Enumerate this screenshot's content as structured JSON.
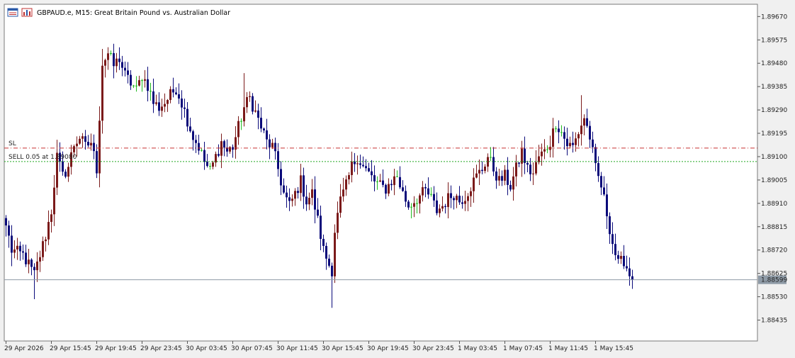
{
  "header": {
    "title": "GBPAUD.e, M15:  Great Britain Pound vs. Australian Dollar",
    "icons": [
      "chart-window-icon",
      "chart-bars-icon"
    ]
  },
  "levels": {
    "sl_label": "SL",
    "sl_price": 1.89135,
    "sell_label": "SELL 0.05 at 1.89080",
    "sell_price": 1.8908,
    "current_price": 1.88599,
    "current_price_label": "1.88599"
  },
  "colors": {
    "background": "#ffffff",
    "frame": "#f0f0f0",
    "bull": "#7b1a1a",
    "bear": "#0a0a7a",
    "doji": "#22bb22",
    "sl_line": "#c83232",
    "sell_line": "#22a822",
    "price_line": "#8e9aa6",
    "price_tag": "#8e9aa6"
  },
  "chart_data": {
    "type": "candlestick",
    "symbol": "GBPAUD.e",
    "timeframe": "M15",
    "ylim": [
      1.8835,
      1.8972
    ],
    "y_ticks": [
      "1.89670",
      "1.89575",
      "1.89480",
      "1.89385",
      "1.89290",
      "1.89195",
      "1.89100",
      "1.89005",
      "1.88910",
      "1.88815",
      "1.88720",
      "1.88625",
      "1.88530",
      "1.88435"
    ],
    "x_ticks": [
      "29 Apr 2026",
      "29 Apr 15:45",
      "29 Apr 19:45",
      "29 Apr 23:45",
      "30 Apr 03:45",
      "30 Apr 07:45",
      "30 Apr 11:45",
      "30 Apr 15:45",
      "30 Apr 19:45",
      "30 Apr 23:45",
      "1 May 03:45",
      "1 May 07:45",
      "1 May 11:45",
      "1 May 15:45"
    ],
    "x_tick_bar_index": [
      0,
      16,
      32,
      48,
      64,
      80,
      96,
      112,
      128,
      144,
      160,
      176,
      192,
      208
    ],
    "anchors": [
      [
        0,
        1.8882
      ],
      [
        2,
        1.8872
      ],
      [
        6,
        1.887
      ],
      [
        10,
        1.8862
      ],
      [
        14,
        1.8878
      ],
      [
        16,
        1.8888
      ],
      [
        18,
        1.891
      ],
      [
        20,
        1.8902
      ],
      [
        22,
        1.8906
      ],
      [
        24,
        1.8915
      ],
      [
        26,
        1.8918
      ],
      [
        28,
        1.8914
      ],
      [
        30,
        1.8916
      ],
      [
        32,
        1.8905
      ],
      [
        34,
        1.8948
      ],
      [
        36,
        1.8952
      ],
      [
        38,
        1.8947
      ],
      [
        40,
        1.895
      ],
      [
        42,
        1.8943
      ],
      [
        44,
        1.894
      ],
      [
        46,
        1.8937
      ],
      [
        48,
        1.8943
      ],
      [
        50,
        1.8939
      ],
      [
        52,
        1.8932
      ],
      [
        54,
        1.893
      ],
      [
        56,
        1.8932
      ],
      [
        58,
        1.8935
      ],
      [
        60,
        1.8938
      ],
      [
        62,
        1.8932
      ],
      [
        64,
        1.8925
      ],
      [
        66,
        1.8918
      ],
      [
        68,
        1.8914
      ],
      [
        70,
        1.8908
      ],
      [
        72,
        1.8904
      ],
      [
        74,
        1.891
      ],
      [
        76,
        1.8916
      ],
      [
        78,
        1.8912
      ],
      [
        80,
        1.8914
      ],
      [
        82,
        1.8922
      ],
      [
        84,
        1.893
      ],
      [
        86,
        1.8934
      ],
      [
        88,
        1.8928
      ],
      [
        90,
        1.8922
      ],
      [
        92,
        1.8916
      ],
      [
        94,
        1.8914
      ],
      [
        96,
        1.8905
      ],
      [
        98,
        1.8895
      ],
      [
        100,
        1.889
      ],
      [
        102,
        1.8895
      ],
      [
        104,
        1.89
      ],
      [
        106,
        1.8892
      ],
      [
        108,
        1.8895
      ],
      [
        110,
        1.8884
      ],
      [
        112,
        1.8872
      ],
      [
        114,
        1.8866
      ],
      [
        115,
        1.8864
      ],
      [
        116,
        1.888
      ],
      [
        118,
        1.8892
      ],
      [
        120,
        1.8898
      ],
      [
        122,
        1.8906
      ],
      [
        124,
        1.891
      ],
      [
        126,
        1.8906
      ],
      [
        128,
        1.8903
      ],
      [
        130,
        1.89
      ],
      [
        132,
        1.8898
      ],
      [
        134,
        1.8897
      ],
      [
        136,
        1.89
      ],
      [
        138,
        1.8902
      ],
      [
        140,
        1.8895
      ],
      [
        142,
        1.889
      ],
      [
        144,
        1.8892
      ],
      [
        146,
        1.8894
      ],
      [
        148,
        1.8896
      ],
      [
        150,
        1.8893
      ],
      [
        152,
        1.8888
      ],
      [
        154,
        1.889
      ],
      [
        156,
        1.8893
      ],
      [
        158,
        1.8895
      ],
      [
        160,
        1.8892
      ],
      [
        162,
        1.8894
      ],
      [
        164,
        1.8898
      ],
      [
        166,
        1.8902
      ],
      [
        168,
        1.8905
      ],
      [
        170,
        1.891
      ],
      [
        172,
        1.8905
      ],
      [
        174,
        1.89
      ],
      [
        176,
        1.8902
      ],
      [
        178,
        1.8898
      ],
      [
        180,
        1.8905
      ],
      [
        182,
        1.8912
      ],
      [
        184,
        1.8905
      ],
      [
        186,
        1.8903
      ],
      [
        188,
        1.891
      ],
      [
        190,
        1.8912
      ],
      [
        192,
        1.8916
      ],
      [
        194,
        1.8924
      ],
      [
        196,
        1.892
      ],
      [
        198,
        1.8915
      ],
      [
        200,
        1.8914
      ],
      [
        202,
        1.892
      ],
      [
        204,
        1.8926
      ],
      [
        206,
        1.8918
      ],
      [
        208,
        1.8905
      ],
      [
        210,
        1.8898
      ],
      [
        212,
        1.8887
      ],
      [
        214,
        1.8875
      ],
      [
        216,
        1.8866
      ],
      [
        218,
        1.8868
      ],
      [
        220,
        1.8862
      ],
      [
        221,
        1.886
      ]
    ],
    "highlights": [
      {
        "i": 36,
        "high": 1.89545
      },
      {
        "i": 84,
        "high": 1.8944
      },
      {
        "i": 115,
        "low": 1.88485
      },
      {
        "i": 203,
        "high": 1.8935
      },
      {
        "i": 10,
        "low": 1.8852
      }
    ],
    "last_close": 1.88599
  }
}
